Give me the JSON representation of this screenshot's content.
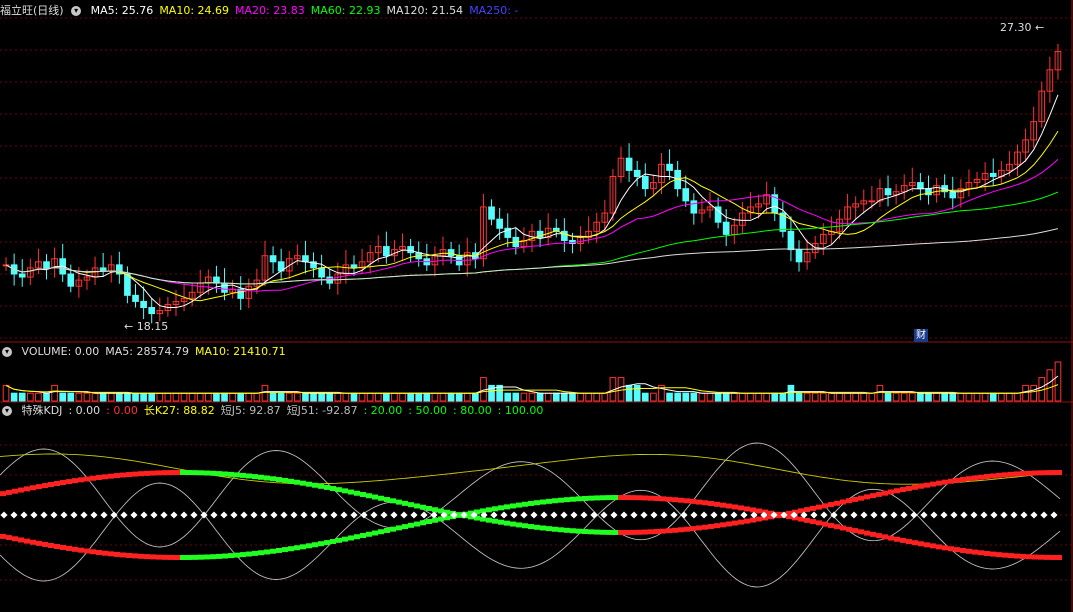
{
  "main": {
    "title": "福立旺(日线)",
    "ma": [
      {
        "label": "MA5: 25.76",
        "color": "#ffffff"
      },
      {
        "label": "MA10: 24.69",
        "color": "#ffff00"
      },
      {
        "label": "MA20: 23.83",
        "color": "#ff00ff"
      },
      {
        "label": "MA60: 22.93",
        "color": "#00ff00"
      },
      {
        "label": "MA120: 21.54",
        "color": "#dddddd"
      },
      {
        "label": "MA250: -",
        "color": "#4444ff"
      }
    ],
    "high_label": "27.30",
    "low_label": "18.15",
    "badge": "财"
  },
  "volume": {
    "items": [
      {
        "label": "VOLUME: 0.00",
        "color": "#dddddd"
      },
      {
        "label": "MA5: 28574.79",
        "color": "#dddddd"
      },
      {
        "label": "MA10: 21410.71",
        "color": "#ffff00"
      }
    ]
  },
  "kdj": {
    "items": [
      {
        "label": "特殊KDJ",
        "color": "#dddddd"
      },
      {
        "label": ": 0.00",
        "color": "#dddddd"
      },
      {
        "label": ": 0.00",
        "color": "#ff3333"
      },
      {
        "label": "长K27: 88.82",
        "color": "#ffff00"
      },
      {
        "label": "短J5: 92.87",
        "color": "#bbbbbb"
      },
      {
        "label": "短J51: -92.87",
        "color": "#bbbbbb"
      },
      {
        "label": ": 20.00",
        "color": "#00ff00"
      },
      {
        "label": ": 50.00",
        "color": "#00ff00"
      },
      {
        "label": ": 80.00",
        "color": "#00ff00"
      },
      {
        "label": ": 100.00",
        "color": "#00ff00"
      }
    ]
  },
  "colors": {
    "up": "#ff3333",
    "down": "#54fcfc",
    "grid": "#7a1010"
  },
  "chart_data": {
    "type": "candlestick",
    "ylim": [
      17.5,
      28.0
    ],
    "close": [
      19.9,
      19.6,
      19.5,
      19.8,
      20.0,
      19.8,
      20.1,
      19.6,
      19.2,
      19.4,
      19.5,
      19.8,
      19.7,
      19.9,
      19.6,
      18.9,
      18.7,
      18.5,
      18.3,
      18.4,
      18.6,
      18.7,
      18.8,
      19.0,
      19.3,
      19.5,
      19.3,
      19.0,
      19.1,
      18.8,
      19.2,
      19.4,
      20.2,
      20.0,
      19.7,
      20.1,
      20.2,
      20.0,
      19.8,
      19.5,
      19.3,
      19.6,
      19.9,
      19.8,
      20.0,
      20.3,
      20.5,
      20.2,
      20.4,
      20.5,
      20.3,
      20.1,
      19.9,
      20.2,
      20.4,
      20.2,
      19.9,
      20.3,
      20.1,
      21.8,
      21.4,
      21.1,
      20.8,
      20.5,
      20.7,
      21.0,
      20.8,
      21.1,
      21.0,
      20.7,
      20.6,
      20.8,
      21.0,
      21.3,
      21.6,
      22.8,
      23.4,
      23.0,
      22.8,
      22.4,
      22.6,
      23.2,
      23.0,
      22.4,
      22.0,
      21.6,
      21.7,
      21.8,
      21.3,
      20.9,
      21.2,
      21.6,
      21.8,
      21.9,
      22.2,
      21.6,
      21.0,
      20.4,
      20.0,
      20.3,
      20.6,
      20.9,
      21.0,
      21.4,
      21.8,
      21.9,
      22.0,
      22.0,
      22.4,
      22.2,
      22.3,
      22.5,
      22.6,
      22.4,
      22.2,
      22.5,
      22.3,
      22.1,
      22.4,
      22.6,
      22.7,
      22.9,
      22.8,
      23.0,
      23.2,
      23.6,
      24.0,
      24.6,
      25.6,
      26.3,
      26.9
    ],
    "volume": [
      2,
      1,
      1,
      1,
      1,
      1,
      2,
      1,
      1,
      1,
      1,
      1,
      1,
      1,
      1,
      1,
      1,
      1,
      1,
      1,
      1,
      1,
      1,
      1,
      1,
      1,
      1,
      1,
      1,
      1,
      1,
      1,
      2,
      1,
      1,
      1,
      1,
      1,
      1,
      1,
      1,
      1,
      1,
      1,
      1,
      1,
      1,
      1,
      1,
      1,
      1,
      1,
      1,
      1,
      1,
      1,
      1,
      1,
      1,
      3,
      2,
      2,
      1,
      1,
      1,
      1,
      1,
      1,
      1,
      1,
      1,
      1,
      1,
      1,
      1,
      3,
      3,
      2,
      2,
      1,
      1,
      2,
      1,
      1,
      1,
      1,
      1,
      1,
      1,
      1,
      1,
      1,
      1,
      1,
      1,
      1,
      1,
      2,
      1,
      1,
      1,
      1,
      1,
      1,
      1,
      1,
      1,
      1,
      2,
      1,
      1,
      1,
      1,
      1,
      1,
      1,
      1,
      1,
      1,
      1,
      1,
      1,
      1,
      1,
      1,
      1,
      2,
      2,
      3,
      4,
      5
    ],
    "kdj_ref_lines": [
      20,
      50,
      80,
      100
    ]
  }
}
